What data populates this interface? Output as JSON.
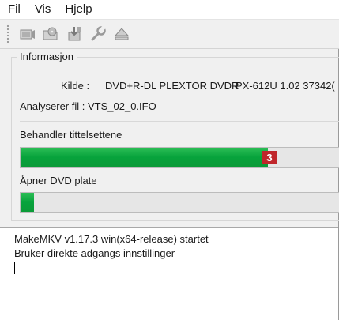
{
  "menu": {
    "items": [
      "Fil",
      "Vis",
      "Hjelp"
    ]
  },
  "toolbar": {
    "buttons": [
      "open-files-icon",
      "open-dvd-icon",
      "backup-icon",
      "settings-wrench-icon",
      "eject-icon"
    ]
  },
  "info": {
    "title": "Informasjon",
    "source_label": "Kilde :",
    "source_value": "DVD+R-DL PLEXTOR DVDR",
    "source_value2": "PX-612U 1.02 37342(",
    "analyze_label": "Analyserer fil :",
    "analyze_value": "VTS_02_0.IFO",
    "progress1_label": "Behandler tittelsettene",
    "progress1_fraction": 0.745,
    "progress1_badge": "3",
    "progress2_label": "Åpner DVD plate",
    "progress2_fraction": 0.04
  },
  "colors": {
    "progress_green": "#07a33c",
    "badge_red": "#c0262b"
  },
  "log": {
    "lines": [
      "MakeMKV v1.17.3 win(x64-release) startet",
      "Bruker direkte adgangs innstillinger"
    ]
  }
}
